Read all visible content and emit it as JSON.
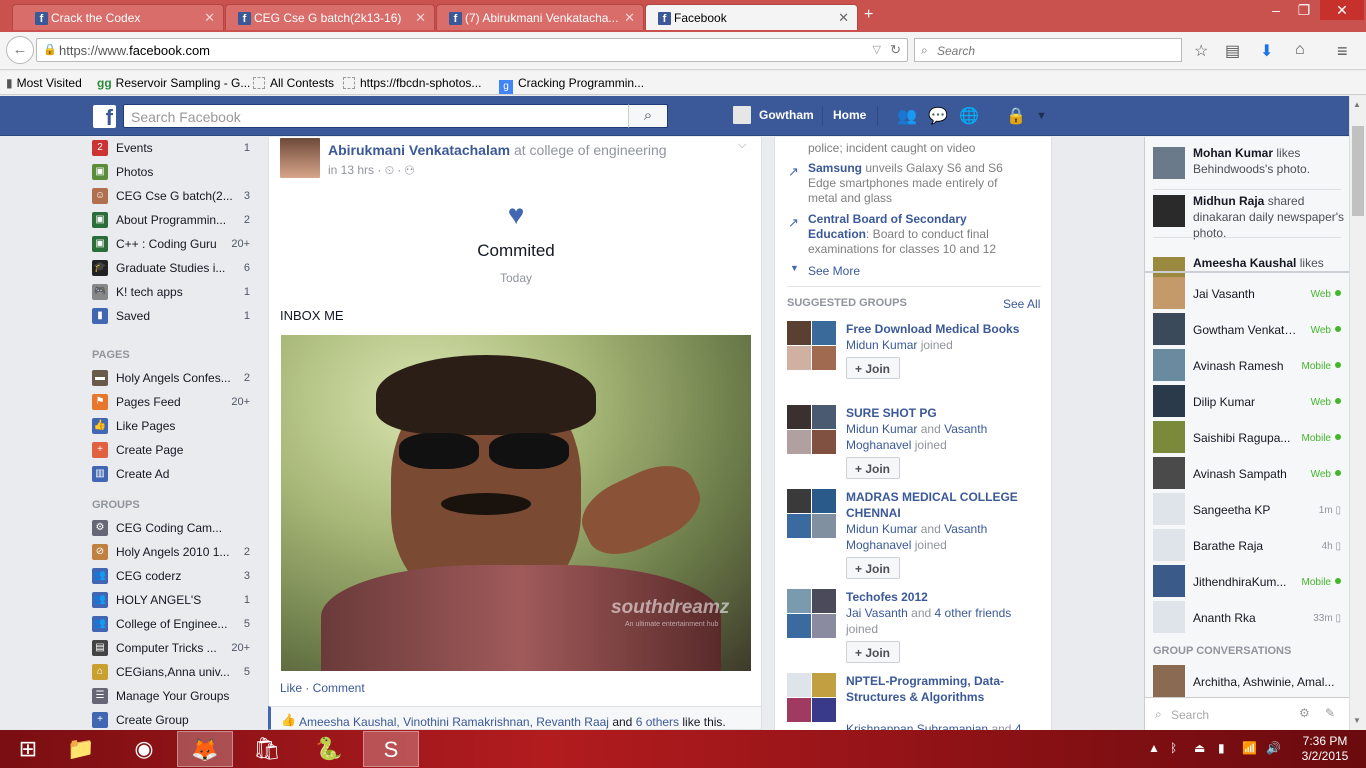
{
  "browser": {
    "tabs": [
      {
        "title": "Crack the Codex",
        "active": false
      },
      {
        "title": "CEG Cse G batch(2k13-16)",
        "active": false
      },
      {
        "title": "(7) Abirukmani Venkatacha...",
        "active": false
      },
      {
        "title": "Facebook",
        "active": true
      }
    ],
    "new_tab": "+",
    "url_prefix": "https://www.",
    "url_domain": "facebook.com",
    "search_placeholder": "Search",
    "bookmarks": [
      "Most Visited",
      "Reservoir Sampling - G...",
      "All Contests",
      "https://fbcdn-sphotos...",
      "Cracking Programmin..."
    ]
  },
  "fb": {
    "search_placeholder": "Search Facebook",
    "user": "Gowtham",
    "home": "Home"
  },
  "left": {
    "items": [
      {
        "label": "Events",
        "count": "1",
        "color": "#c33",
        "icon": "2"
      },
      {
        "label": "Photos",
        "count": "",
        "color": "#5a8c3c",
        "icon": "▣"
      },
      {
        "label": "CEG Cse G batch(2...",
        "count": "3",
        "color": "#b07050",
        "icon": "☺"
      },
      {
        "label": "About Programmin...",
        "count": "2",
        "color": "#2b6e3a",
        "icon": "▣"
      },
      {
        "label": "C++ : Coding Guru",
        "count": "20+",
        "color": "#2b6e3a",
        "icon": "▣"
      },
      {
        "label": "Graduate Studies i...",
        "count": "6",
        "color": "#222",
        "icon": "🎓"
      },
      {
        "label": "K! tech apps",
        "count": "1",
        "color": "#888",
        "icon": "🎮"
      },
      {
        "label": "Saved",
        "count": "1",
        "color": "#4267b2",
        "icon": "▮"
      }
    ],
    "pages_header": "PAGES",
    "pages": [
      {
        "label": "Holy Angels Confes...",
        "count": "2",
        "color": "#6a5a4a",
        "icon": "▬"
      },
      {
        "label": "Pages Feed",
        "count": "20+",
        "color": "#e8772e",
        "icon": "⚑"
      },
      {
        "label": "Like Pages",
        "count": "",
        "color": "#4267b2",
        "icon": "👍"
      },
      {
        "label": "Create Page",
        "count": "",
        "color": "#e06040",
        "icon": "+"
      },
      {
        "label": "Create Ad",
        "count": "",
        "color": "#4267b2",
        "icon": "▥"
      }
    ],
    "groups_header": "GROUPS",
    "groups": [
      {
        "label": "CEG Coding Cam...",
        "count": "",
        "color": "#667",
        "icon": "⚙"
      },
      {
        "label": "Holy Angels 2010 1...",
        "count": "2",
        "color": "#c08040",
        "icon": "⊘"
      },
      {
        "label": "CEG coderz",
        "count": "3",
        "color": "#4267b2",
        "icon": "👥"
      },
      {
        "label": "HOLY ANGEL'S",
        "count": "1",
        "color": "#4267b2",
        "icon": "👥"
      },
      {
        "label": "College of Enginee...",
        "count": "5",
        "color": "#4267b2",
        "icon": "👥"
      },
      {
        "label": "Computer Tricks ...",
        "count": "20+",
        "color": "#444",
        "icon": "▤"
      },
      {
        "label": "CEGians,Anna univ...",
        "count": "5",
        "color": "#c9a030",
        "icon": "⌂"
      },
      {
        "label": "Manage Your Groups",
        "count": "",
        "color": "#667",
        "icon": "☰"
      },
      {
        "label": "Create Group",
        "count": "",
        "color": "#4267b2",
        "icon": "+"
      }
    ]
  },
  "post": {
    "author": "Abirukmani Venkatachalam",
    "location": "at college of engineering",
    "time": "in 13 hrs · ⏲ · ⚇",
    "life_event_title": "Commited",
    "life_event_date": "Today",
    "message": "INBOX ME",
    "watermark": "southdreamz",
    "watermark_sub": "An ultimate entertainment hub",
    "actions": "Like · Comment",
    "likers": "Ameesha Kaushal, Vinothini Ramakrishnan, Revanth Raaj",
    "and": "and",
    "others": "6 others",
    "like_suffix": "like this."
  },
  "trending": [
    {
      "title": "",
      "text": "police; incident caught on video"
    },
    {
      "title": "Samsung",
      "text": "unveils Galaxy S6 and S6 Edge smartphones made entirely of metal and glass"
    },
    {
      "title": "Central Board of Secondary Education",
      "text": ": Board to conduct final examinations for classes 10 and 12"
    }
  ],
  "see_more": "See More",
  "suggested": {
    "header": "SUGGESTED GROUPS",
    "see_all": "See All",
    "join_label": "Join",
    "groups": [
      {
        "name": "Free Download Medical Books",
        "sub1": "Midun Kumar",
        "sub2": "",
        "tail": "joined"
      },
      {
        "name": "SURE SHOT PG",
        "sub1": "Midun Kumar",
        "sub2": "Vasanth Moghanavel",
        "tail": "joined"
      },
      {
        "name": "MADRAS MEDICAL COLLEGE CHENNAI",
        "sub1": "Midun Kumar",
        "sub2": "Vasanth Moghanavel",
        "tail": "joined"
      },
      {
        "name": "Techofes 2012",
        "sub1": "Jai Vasanth",
        "sub2": "4 other friends",
        "tail": "joined"
      },
      {
        "name": "NPTEL-Programming, Data-Structures & Algorithms",
        "sub1": "Krishnappan Subramanian",
        "sub2": "4",
        "tail": ""
      }
    ],
    "and": "and"
  },
  "ticker": [
    {
      "name": "Mohan Kumar",
      "text": "likes Behindwoods's photo."
    },
    {
      "name": "Midhun Raja",
      "text": "shared dinakaran daily newspaper's photo."
    },
    {
      "name": "Ameesha Kaushal",
      "text": "likes"
    }
  ],
  "friends": [
    {
      "name": "Jai Vasanth",
      "status": "Web",
      "online": true
    },
    {
      "name": "Gowtham Venkate...",
      "status": "Web",
      "online": true
    },
    {
      "name": "Avinash Ramesh",
      "status": "Mobile",
      "online": true
    },
    {
      "name": "Dilip Kumar",
      "status": "Web",
      "online": true
    },
    {
      "name": "Saishibi Ragupa...",
      "status": "Mobile",
      "online": true
    },
    {
      "name": "Avinash Sampath",
      "status": "Web",
      "online": true
    },
    {
      "name": "Sangeetha KP",
      "status": "1m",
      "online": false
    },
    {
      "name": "Barathe Raja",
      "status": "4h",
      "online": false
    },
    {
      "name": "JithendhiraKum...",
      "status": "Mobile",
      "online": true
    },
    {
      "name": "Ananth Rka",
      "status": "33m",
      "online": false
    }
  ],
  "group_conversations": {
    "header": "GROUP CONVERSATIONS",
    "item": "Architha, Ashwinie, Amal..."
  },
  "chat_search": "Search",
  "taskbar": {
    "time": "7:36 PM",
    "date": "3/2/2015"
  }
}
